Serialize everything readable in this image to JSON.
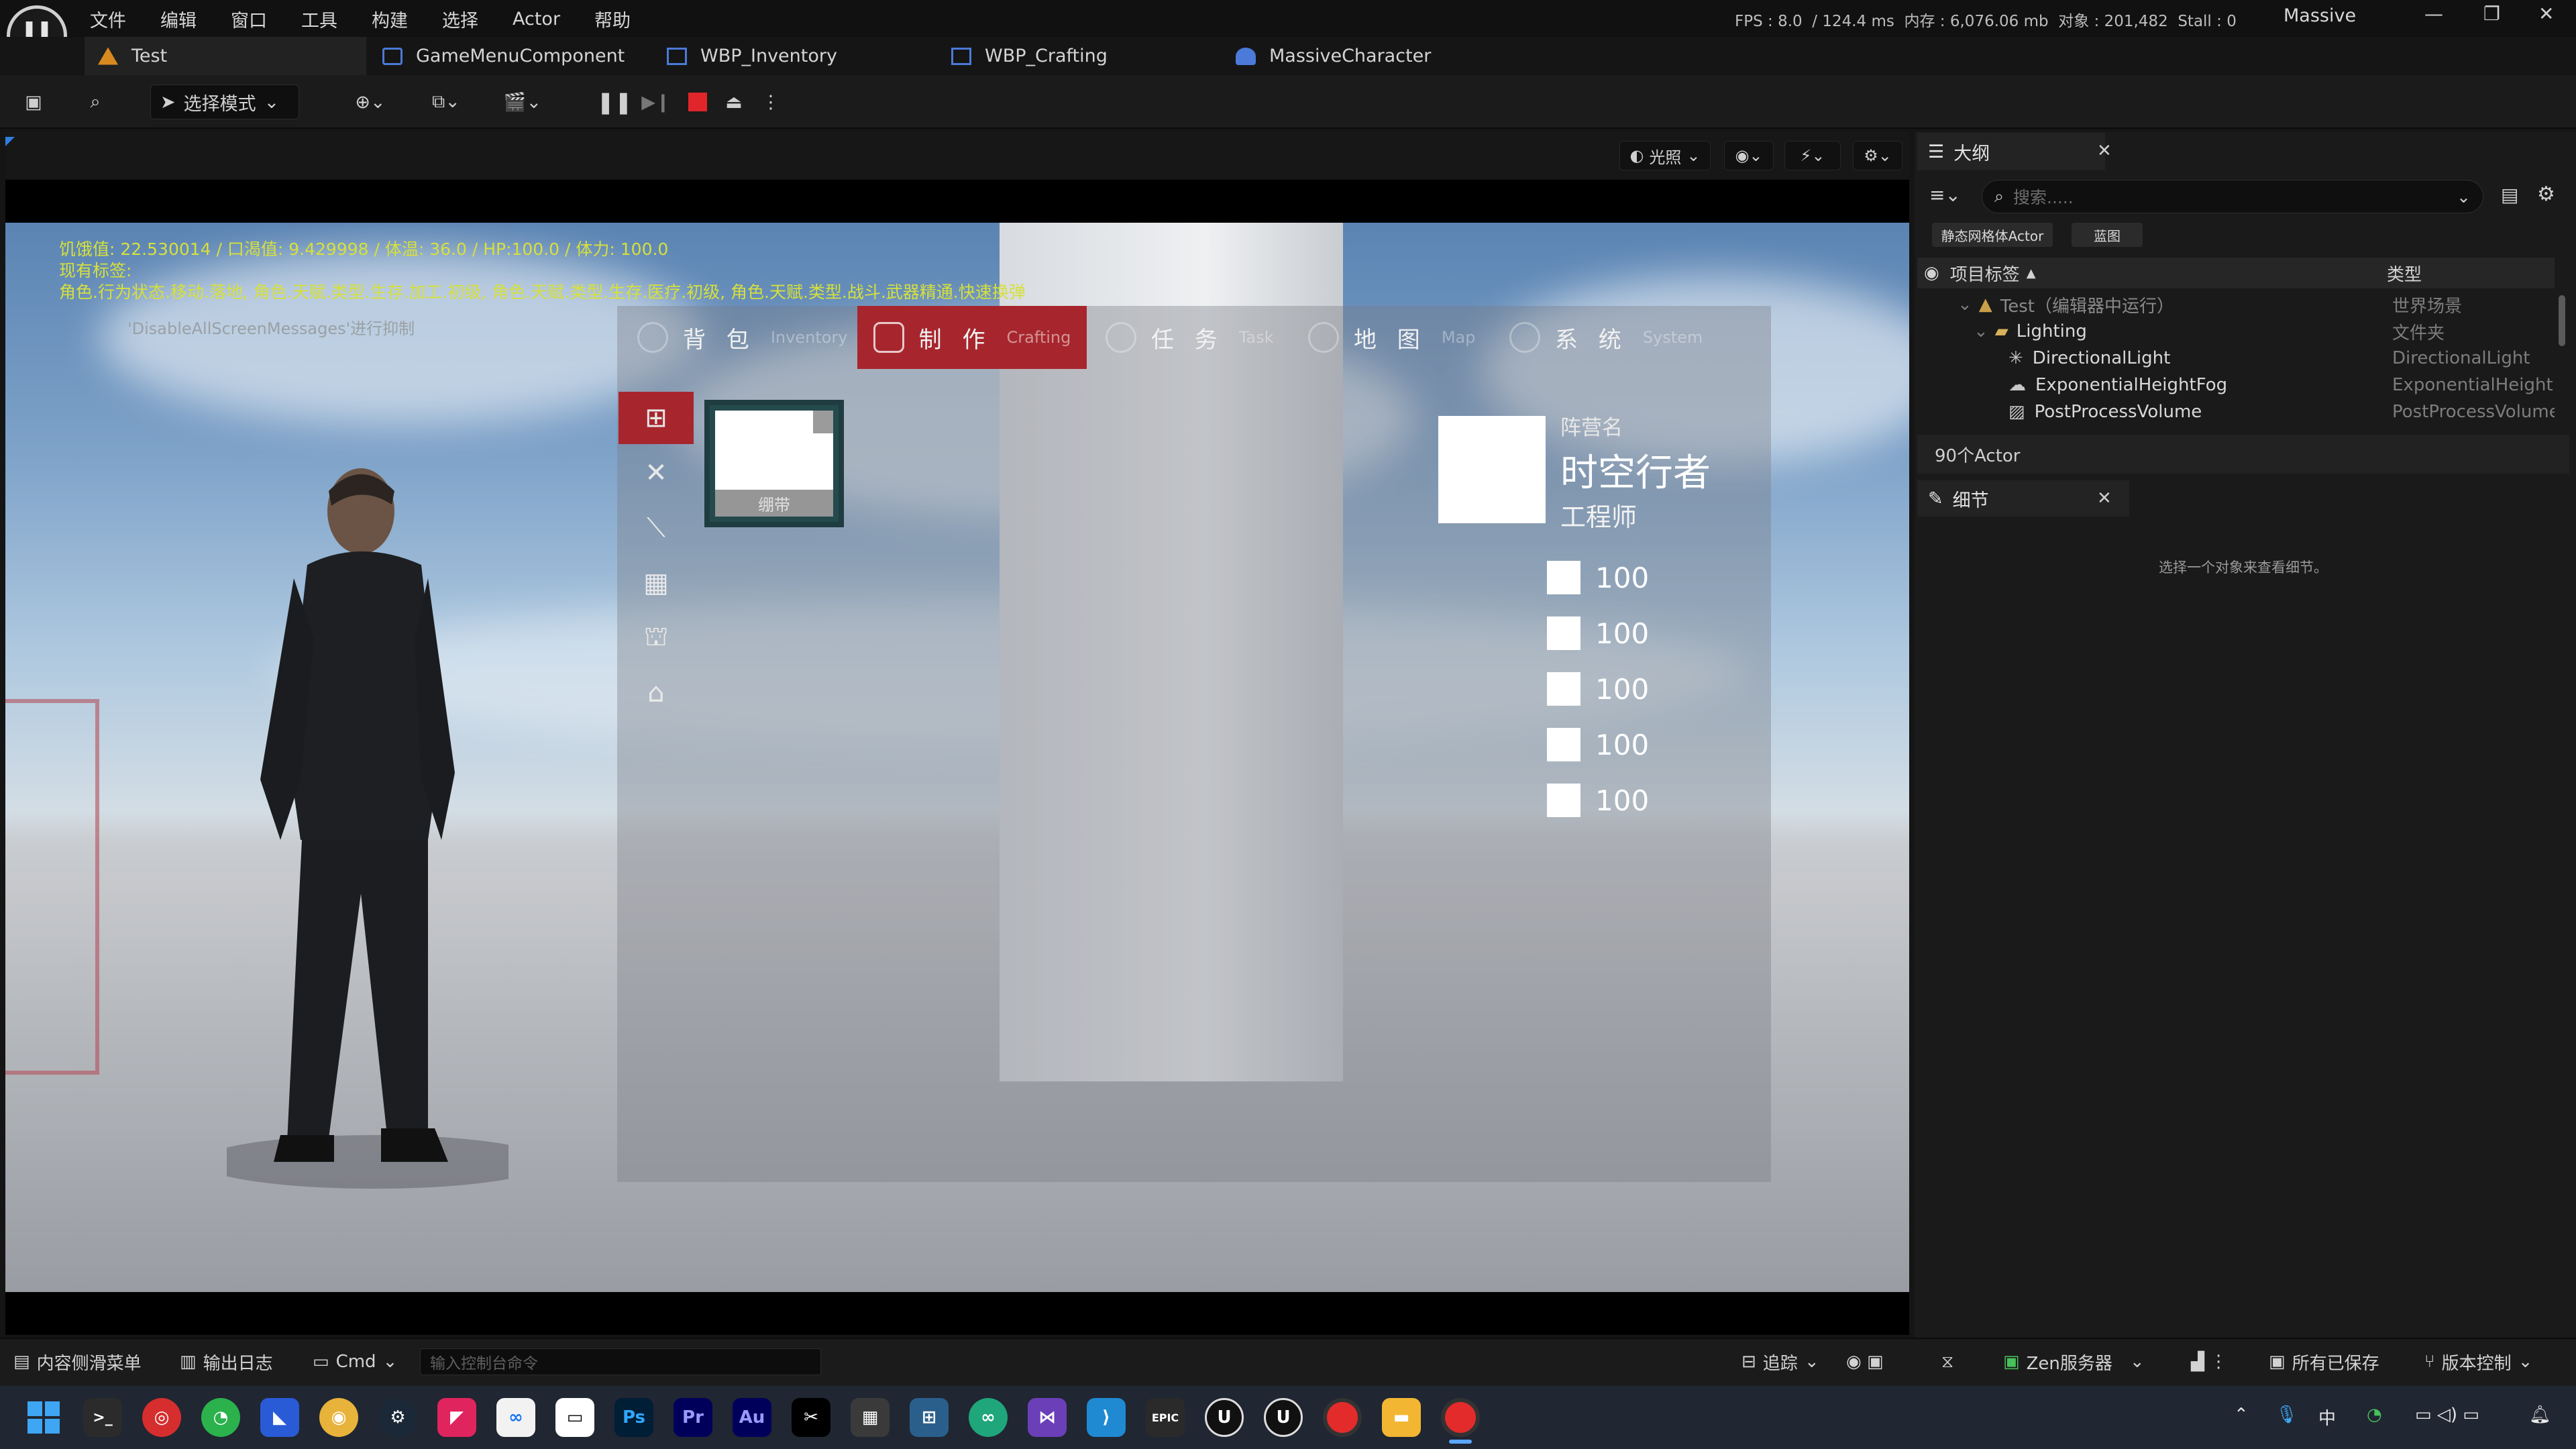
{
  "app": {
    "menu": [
      "文件",
      "编辑",
      "窗口",
      "工具",
      "构建",
      "选择",
      "Actor",
      "帮助"
    ],
    "stats": "FPS : 8.0  / 124.4 ms  内存 : 6,076.06 mb  对象 : 201,482  Stall : 0",
    "project": "Massive",
    "tabs": [
      "Test",
      "GameMenuComponent",
      "WBP_Inventory",
      "WBP_Crafting",
      "MassiveCharacter"
    ],
    "mode_label": "选择模式"
  },
  "viewport": {
    "lighting_label": "光照",
    "hud_line1": "饥饿值: 22.530014 / 口渴值: 9.429998 / 体温: 36.0 / HP:100.0 / 体力: 100.0",
    "hud_line2": "现有标签:",
    "hud_line3": "角色.行为状态.移动.落地, 角色.天赋.类型.生存.加工.初级, 角色.天赋.类型.生存.医疗.初级, 角色.天赋.类型.战斗.武器精通.快速换弹",
    "hud_suppressed": "'DisableAllScreenMessages'进行抑制"
  },
  "inventory": {
    "nav": [
      {
        "zh": "背 包",
        "en": "Inventory"
      },
      {
        "zh": "制 作",
        "en": "Crafting"
      },
      {
        "zh": "任 务",
        "en": "Task"
      },
      {
        "zh": "地 图",
        "en": "Map"
      },
      {
        "zh": "系 统",
        "en": "System"
      }
    ],
    "slot_label": "绷带",
    "faction_label": "阵营名",
    "faction_name": "时空行者",
    "faction_role": "工程师",
    "stats": [
      "100",
      "100",
      "100",
      "100",
      "100"
    ]
  },
  "outliner": {
    "title": "大纲",
    "search_placeholder": "搜索.....",
    "filters": [
      "静态网格体Actor",
      "蓝图"
    ],
    "col_label": "项目标签",
    "col_type": "类型",
    "rows": [
      {
        "name": "Test（编辑器中运行）",
        "type": "世界场景"
      },
      {
        "name": "Lighting",
        "type": "文件夹"
      },
      {
        "name": "DirectionalLight",
        "type": "DirectionalLight"
      },
      {
        "name": "ExponentialHeightFog",
        "type": "ExponentialHeightFog"
      },
      {
        "name": "PostProcessVolume",
        "type": "PostProcessVolume"
      }
    ],
    "actor_count": "90个Actor"
  },
  "details": {
    "title": "细节",
    "empty": "选择一个对象来查看细节。"
  },
  "statusbar": {
    "content_drawer": "内容侧滑菜单",
    "output_log": "输出日志",
    "cmd": "Cmd",
    "console_placeholder": "输入控制台命令",
    "trace": "追踪",
    "zen": "Zen服务器",
    "saved": "所有已保存",
    "source_control": "版本控制"
  },
  "taskbar": {
    "ime": "中"
  },
  "colors": {
    "accent_red": "#a7262d",
    "hud_yellow": "#d6e03c"
  }
}
